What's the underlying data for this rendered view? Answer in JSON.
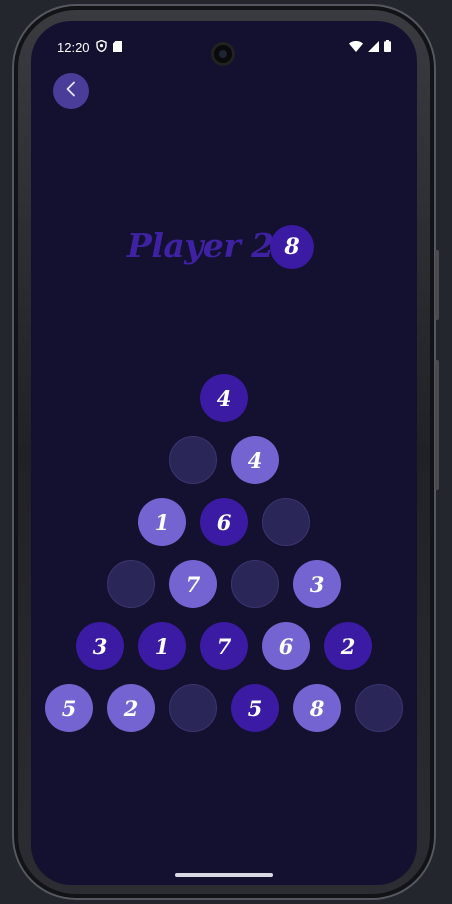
{
  "status_bar": {
    "time": "12:20",
    "left_icons": [
      "vpn-shield-icon",
      "sim-card-icon"
    ],
    "right_icons": [
      "wifi-icon",
      "signal-icon",
      "battery-icon"
    ]
  },
  "nav": {
    "back_icon": "chevron-left-icon"
  },
  "header": {
    "player_label": "Player 2",
    "score": "8"
  },
  "colors": {
    "background": "#13112f",
    "dark_ball": "#3b1aa4",
    "light_ball": "#7364d2",
    "empty_slot": "#2a2657",
    "title": "#3f22a3",
    "back_button": "#4a3d9a"
  },
  "pyramid": {
    "rows": [
      [
        {
          "value": "4",
          "style": "dark"
        }
      ],
      [
        {
          "value": "",
          "style": "empty"
        },
        {
          "value": "4",
          "style": "light"
        }
      ],
      [
        {
          "value": "1",
          "style": "light"
        },
        {
          "value": "6",
          "style": "dark"
        },
        {
          "value": "",
          "style": "empty"
        }
      ],
      [
        {
          "value": "",
          "style": "empty"
        },
        {
          "value": "7",
          "style": "light"
        },
        {
          "value": "",
          "style": "empty"
        },
        {
          "value": "3",
          "style": "light"
        }
      ],
      [
        {
          "value": "3",
          "style": "dark"
        },
        {
          "value": "1",
          "style": "dark"
        },
        {
          "value": "7",
          "style": "dark"
        },
        {
          "value": "6",
          "style": "light"
        },
        {
          "value": "2",
          "style": "dark"
        }
      ],
      [
        {
          "value": "5",
          "style": "light"
        },
        {
          "value": "2",
          "style": "light"
        },
        {
          "value": "",
          "style": "empty"
        },
        {
          "value": "5",
          "style": "dark"
        },
        {
          "value": "8",
          "style": "light"
        },
        {
          "value": "",
          "style": "empty"
        }
      ]
    ]
  }
}
